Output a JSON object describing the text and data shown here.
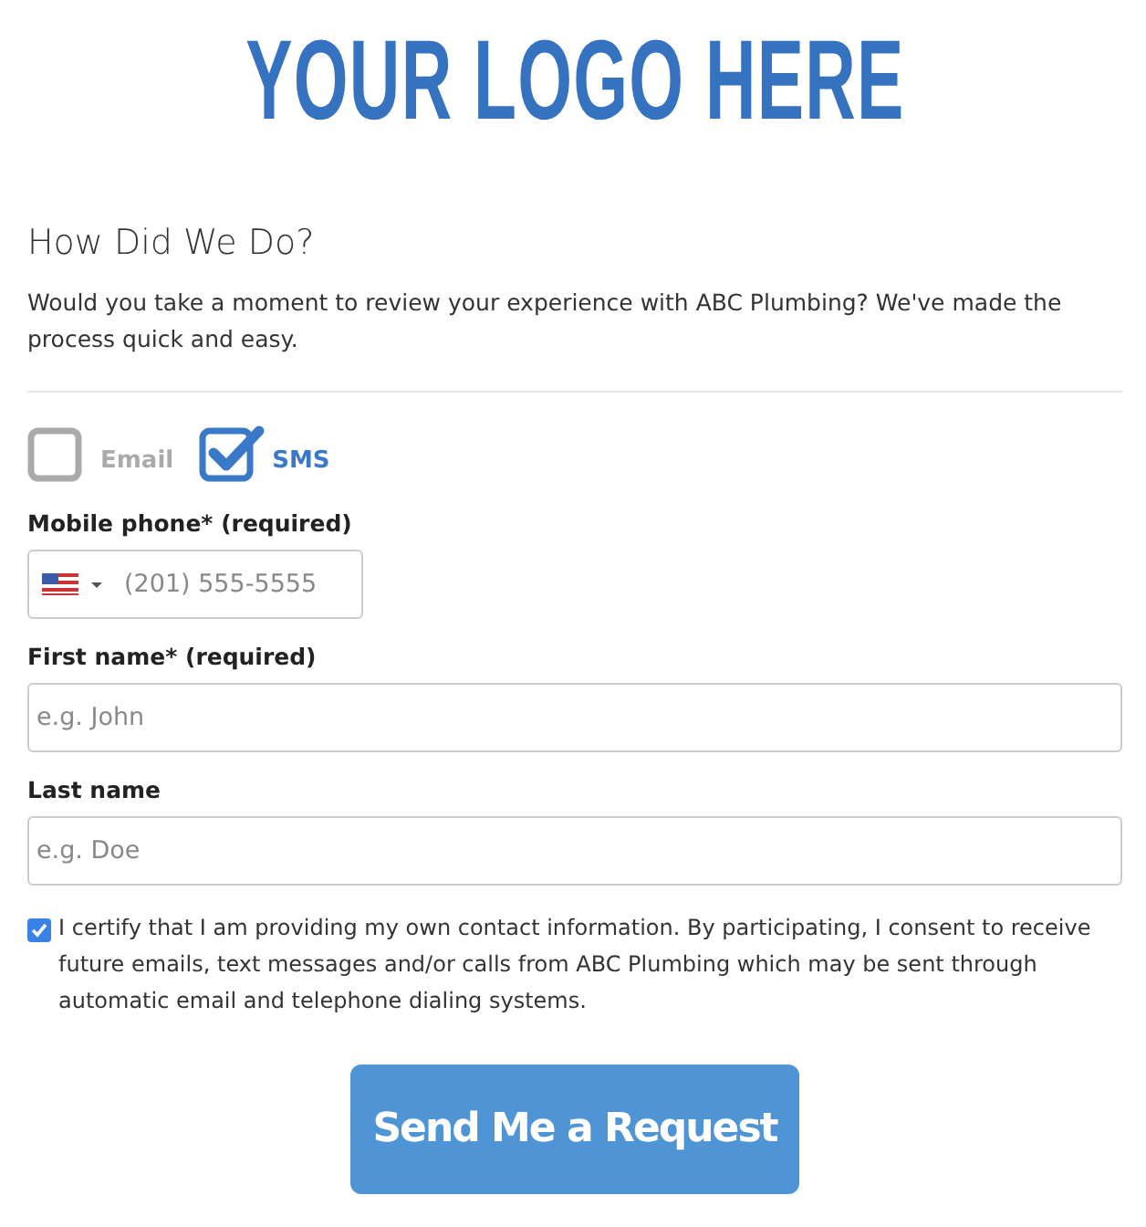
{
  "logo": {
    "text": "YOUR LOGO HERE"
  },
  "heading": "How Did We Do?",
  "intro": "Would you take a moment to review your experience with ABC Plumbing? We've made the process quick and easy.",
  "channels": [
    {
      "label": "Email",
      "checked": false
    },
    {
      "label": "SMS",
      "checked": true
    }
  ],
  "fields": [
    {
      "kind": "phone",
      "label": "Mobile phone* (required)",
      "placeholder": "(201) 555-5555"
    },
    {
      "kind": "text",
      "label": "First name* (required)",
      "placeholder": "e.g. John"
    },
    {
      "kind": "text",
      "label": "Last name",
      "placeholder": "e.g. Doe"
    }
  ],
  "consent": {
    "checked": true,
    "text": "I certify that I am providing my own contact information. By participating, I consent to receive future emails, text messages and/or calls from ABC Plumbing which may be sent through automatic email and telephone dialing systems."
  },
  "submit": "Send Me a Request"
}
